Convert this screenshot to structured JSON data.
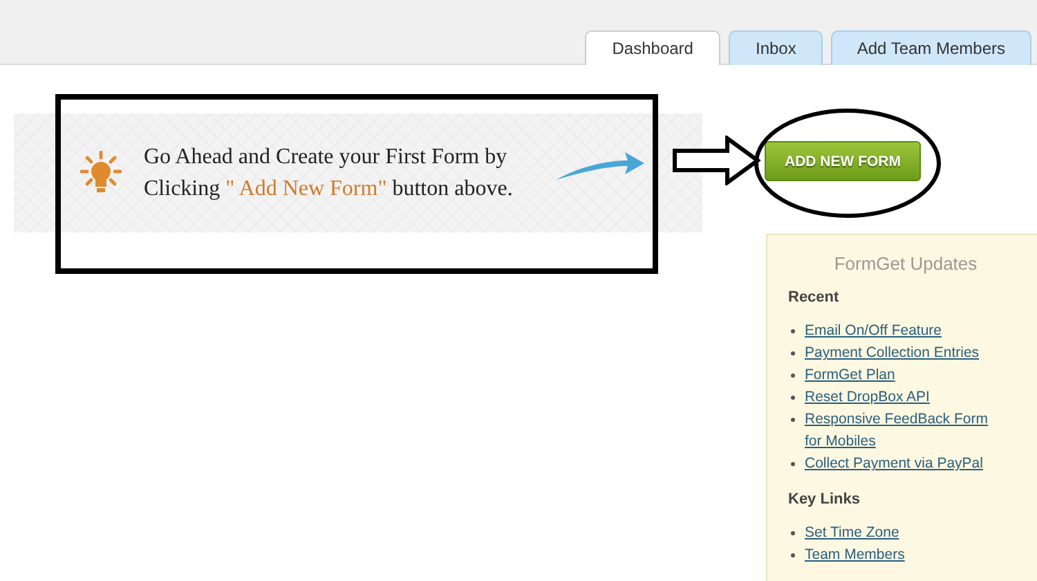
{
  "tabs": [
    {
      "label": "Dashboard",
      "selected": true
    },
    {
      "label": "Inbox",
      "selected": false
    },
    {
      "label": "Add Team Members",
      "selected": false
    }
  ],
  "banner": {
    "message": [
      {
        "text": "Go Ahead and Create your First Form by Clicking ",
        "highlight": false
      },
      {
        "text": "\" Add New Form\"",
        "highlight": true
      },
      {
        "text": " button above.",
        "highlight": false
      }
    ]
  },
  "add_button": {
    "label": "ADD NEW FORM"
  },
  "sidebar": {
    "title": "FormGet Updates",
    "sections": [
      {
        "heading": "Recent",
        "links": [
          "Email On/Off Feature",
          "Payment Collection Entries",
          "FormGet Plan",
          "Reset DropBox API",
          "Responsive FeedBack Form for Mobiles",
          "Collect Payment via PayPal"
        ]
      },
      {
        "heading": "Key Links",
        "links": [
          "Set Time Zone",
          "Team Members"
        ]
      }
    ]
  }
}
